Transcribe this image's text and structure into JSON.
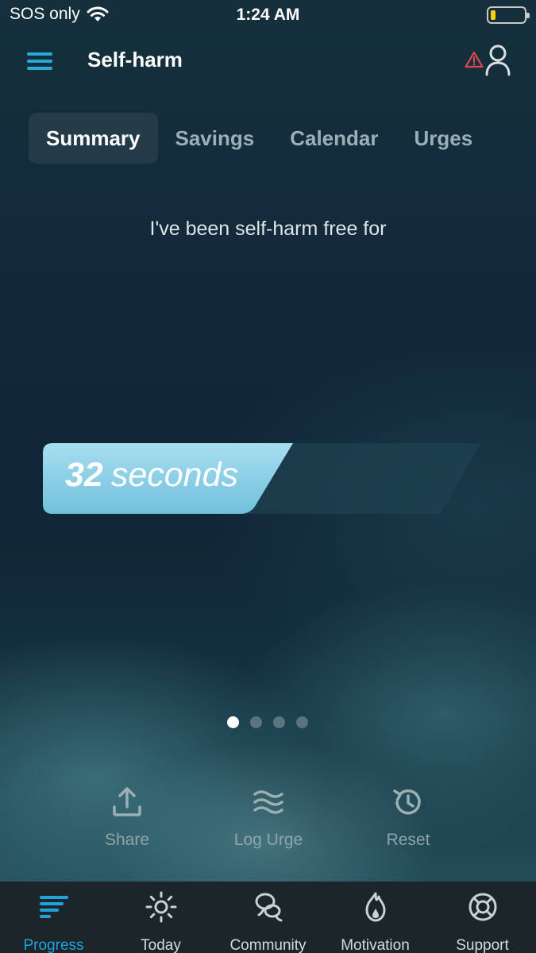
{
  "status_bar": {
    "carrier": "SOS only",
    "time": "1:24 AM",
    "battery_level": 0.15,
    "battery_color": "#f5d400"
  },
  "header": {
    "title": "Self-harm",
    "menu_icon": "hamburger-menu-icon",
    "alert_icon": "warning-triangle-icon",
    "profile_icon": "user-profile-icon",
    "accent_color": "#2aa9d8",
    "alert_color": "#e04848"
  },
  "tabs": [
    {
      "label": "Summary",
      "active": true
    },
    {
      "label": "Savings",
      "active": false
    },
    {
      "label": "Calendar",
      "active": false
    },
    {
      "label": "Urges",
      "active": false
    }
  ],
  "summary": {
    "intro": "I've been self-harm free for",
    "counter_value": "32",
    "counter_unit": "seconds",
    "counter_color": "#8fd3ea"
  },
  "pager": {
    "count": 4,
    "active_index": 0
  },
  "actions": [
    {
      "label": "Share",
      "icon": "share-upload-icon"
    },
    {
      "label": "Log Urge",
      "icon": "waves-icon"
    },
    {
      "label": "Reset",
      "icon": "reset-history-icon"
    }
  ],
  "bottom_nav": [
    {
      "label": "Progress",
      "icon": "progress-bars-icon",
      "active": true
    },
    {
      "label": "Today",
      "icon": "sun-icon",
      "active": false
    },
    {
      "label": "Community",
      "icon": "community-chat-icon",
      "active": false
    },
    {
      "label": "Motivation",
      "icon": "motivation-flame-icon",
      "active": false
    },
    {
      "label": "Support",
      "icon": "lifebuoy-icon",
      "active": false
    }
  ],
  "nav_active_color": "#1ea3df"
}
